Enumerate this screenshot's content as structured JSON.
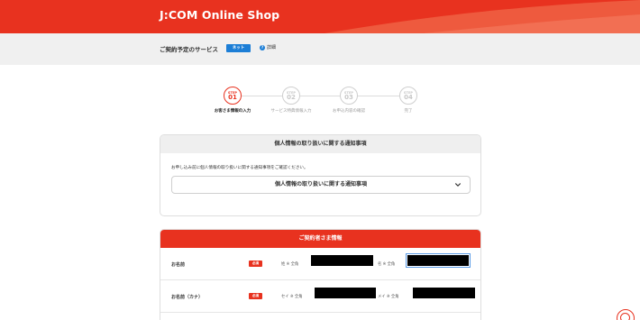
{
  "header": {
    "brand": "J:COM Online Shop",
    "colors": {
      "primary": "#e8321f",
      "accent": "#f06a50"
    }
  },
  "service": {
    "label": "ご契約予定のサービス",
    "badge": "ネット",
    "detail_icon": "info-icon",
    "detail_label": "詳細"
  },
  "stepper": {
    "steps": [
      {
        "step_word": "STEP",
        "num": "01",
        "label": "お客さま情報の入力",
        "active": true
      },
      {
        "step_word": "STEP",
        "num": "02",
        "label": "サービス特典情報入力",
        "active": false
      },
      {
        "step_word": "STEP",
        "num": "03",
        "label": "お申込内容の確認",
        "active": false
      },
      {
        "step_word": "STEP",
        "num": "04",
        "label": "完了",
        "active": false
      }
    ]
  },
  "notice": {
    "title": "個人情報の取り扱いに関する通知事項",
    "description": "お申し込み前に個人情報の取り扱いに関する通知事項をご確認ください。",
    "dropdown_label": "個人情報の取り扱いに関する通知事項",
    "dropdown_icon": "chevron-down-icon"
  },
  "contract": {
    "title": "ご契約者さま情報",
    "rows": [
      {
        "label": "お名前",
        "required": "必須",
        "first_label": "姓 ※ 全角",
        "second_label": "名 ※ 全角"
      },
      {
        "label": "お名前（カナ）",
        "required": "必須",
        "first_label": "セイ ※ 全角",
        "second_label": "メイ ※ 全角"
      }
    ]
  },
  "help": {
    "icon": "help-icon"
  }
}
